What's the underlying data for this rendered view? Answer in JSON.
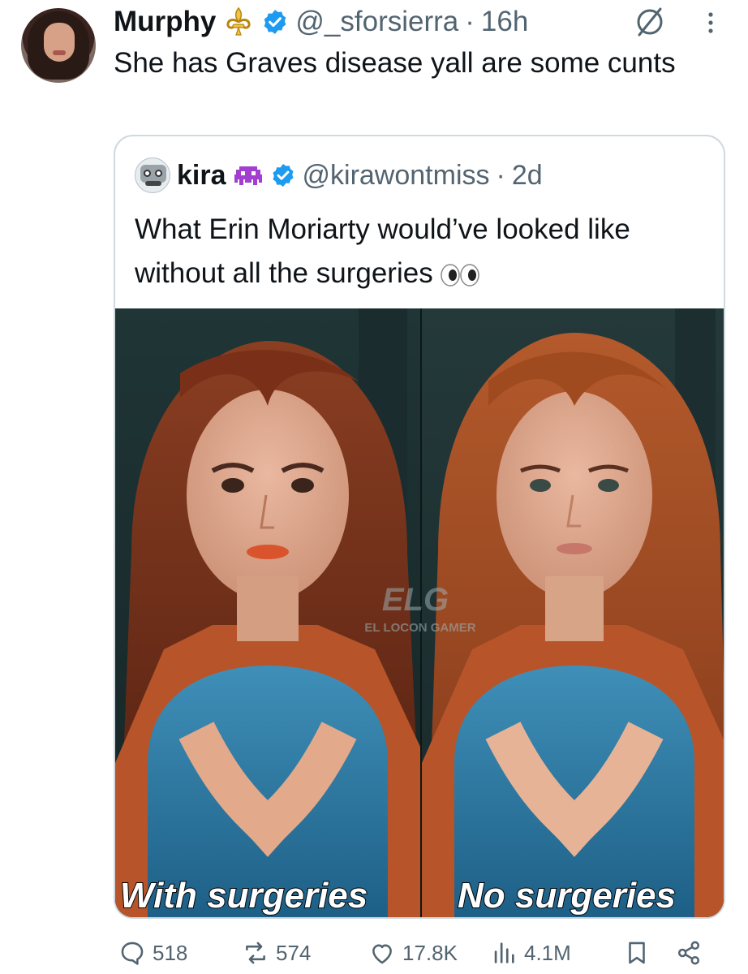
{
  "tweet": {
    "name": "Murphy",
    "handle": "@_sforsierra",
    "separator": "·",
    "time": "16h",
    "text": "She has Graves disease yall are some cunts"
  },
  "quoted": {
    "name": "kira",
    "handle": "@kirawontmiss",
    "separator": "·",
    "time": "2d",
    "text": "What Erin Moriarty would’ve looked like without all the surgeries",
    "media": {
      "left_caption": "With surgeries",
      "right_caption": "No surgeries",
      "watermark_top": "ELG",
      "watermark_bottom": "EL LOCON GAMER"
    }
  },
  "actions": {
    "replies": "518",
    "reposts": "574",
    "likes": "17.8K",
    "views": "4.1M"
  },
  "colors": {
    "verified": "#1d9bf0",
    "secondary_text": "#536471",
    "border": "#cfd9de"
  },
  "icons": [
    "fleur-de-lis-icon",
    "verified-badge-icon",
    "grok-icon",
    "more-icon",
    "alien-icon",
    "eyes-emoji-icon",
    "reply-icon",
    "repost-icon",
    "like-icon",
    "views-icon",
    "bookmark-icon",
    "share-icon"
  ]
}
